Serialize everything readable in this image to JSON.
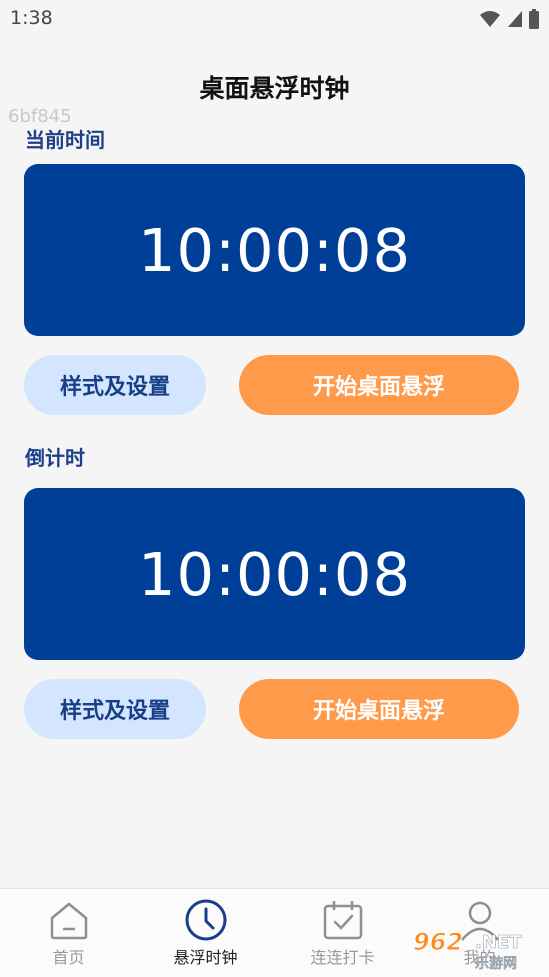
{
  "status_bar": {
    "time": "1:38"
  },
  "header": {
    "title": "桌面悬浮时钟",
    "build_id": "6bf845"
  },
  "current_time": {
    "label": "当前时间",
    "clock": "10:00:08",
    "style_button": "样式及设置",
    "start_button": "开始桌面悬浮"
  },
  "countdown": {
    "label": "倒计时",
    "clock": "10:00:08",
    "style_button": "样式及设置",
    "start_button": "开始桌面悬浮"
  },
  "bottom_nav": {
    "items": [
      {
        "label": "首页",
        "icon": "home-icon",
        "active": false
      },
      {
        "label": "悬浮时钟",
        "icon": "clock-icon",
        "active": true
      },
      {
        "label": "连连打卡",
        "icon": "calendar-check-icon",
        "active": false
      },
      {
        "label": "我的",
        "icon": "user-icon",
        "active": false
      }
    ]
  },
  "watermark": {
    "text_top": "962",
    "text_suffix": ".NET",
    "text_bottom": "乐游网"
  },
  "colors": {
    "clock_bg": "#003f98",
    "style_btn_bg": "#d3e5ff",
    "start_btn_bg": "#ff9a4b",
    "nav_active": "#1a3f8a"
  }
}
